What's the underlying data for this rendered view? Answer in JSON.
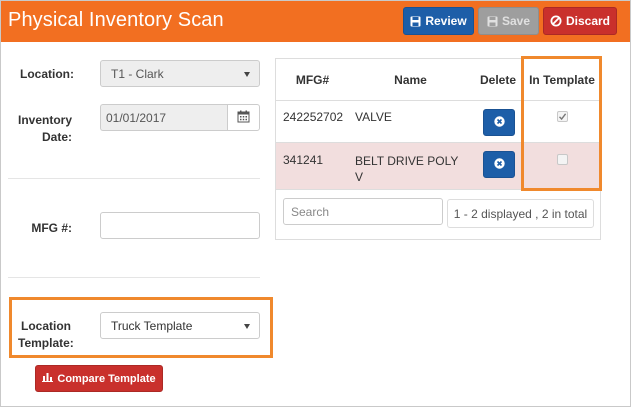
{
  "header": {
    "title": "Physical Inventory Scan",
    "review_label": "Review",
    "save_label": "Save",
    "discard_label": "Discard"
  },
  "form": {
    "location_label": "Location:",
    "location_value": "T1 - Clark",
    "inventory_label_line1": "Inventory",
    "inventory_label_line2": "Date:",
    "inventory_date": "01/01/2017",
    "mfg_label": "MFG #:",
    "mfg_value": "",
    "template_label_line1": "Location",
    "template_label_line2": "Template:",
    "template_value": "Truck Template",
    "compare_label": "Compare Template"
  },
  "table": {
    "columns": [
      "MFG#",
      "Name",
      "Delete",
      "In Template"
    ],
    "rows": [
      {
        "mfg": "242252702",
        "name": "VALVE",
        "in_template": true
      },
      {
        "mfg": "341241",
        "name": "BELT DRIVE POLY V",
        "in_template": false
      }
    ],
    "search_placeholder": "Search",
    "pager_text": "1 - 2 displayed , 2 in total"
  },
  "colors": {
    "header_bg": "#f26f21",
    "primary": "#1d5ea8",
    "danger": "#c9302c",
    "highlight_box": "#f0892d",
    "row_warning": "#f2dede"
  }
}
